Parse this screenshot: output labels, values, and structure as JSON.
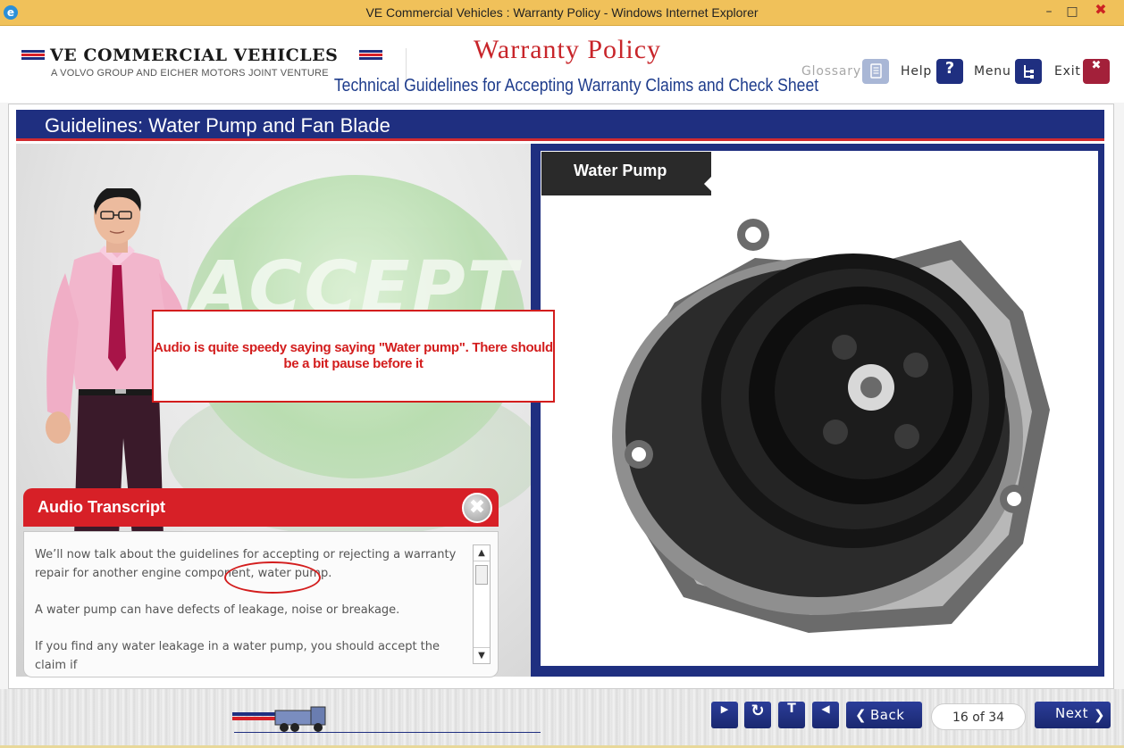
{
  "window": {
    "title": "VE Commercial Vehicles : Warranty Policy - Windows Internet Explorer",
    "app_icon": "internet-explorer-icon",
    "controls": {
      "minimize": "–",
      "maximize": "□",
      "close": "✖"
    }
  },
  "header": {
    "logo_name": "VE COMMERCIAL VEHICLES",
    "logo_tagline": "A VOLVO GROUP AND EICHER MOTORS JOINT VENTURE",
    "course_title": "Warranty Policy",
    "course_subtitle": "Technical Guidelines for Accepting Warranty Claims and Check Sheet",
    "buttons": [
      {
        "label": "Glossary",
        "icon": "glossary-icon",
        "disabled": true
      },
      {
        "label": "Help",
        "icon": "help-icon",
        "glyph": "?"
      },
      {
        "label": "Menu",
        "icon": "menu-icon"
      },
      {
        "label": "Exit",
        "icon": "exit-icon",
        "glyph": "✖"
      }
    ]
  },
  "slide": {
    "title": "Guidelines: Water Pump and Fan Blade",
    "background_word": "ACCEPT",
    "image_label": "Water Pump"
  },
  "annotation": {
    "text": "Audio is quite speedy saying saying \"Water pump\". There should be a bit pause before it",
    "color": "#d31d1d"
  },
  "transcript": {
    "title": "Audio Transcript",
    "close_glyph": "✖",
    "paragraphs": [
      "We’ll now talk about the guidelines for accepting or rejecting a warranty repair for another engine component, water pump.",
      "A water pump can have defects of leakage, noise or breakage.",
      "If you find any water leakage in a water pump, you should accept the claim if"
    ],
    "scroll_up": "▲",
    "scroll_down": "▼"
  },
  "footer": {
    "controls": [
      {
        "name": "play-icon",
        "glyph": "▶"
      },
      {
        "name": "replay-icon",
        "glyph": "↻"
      },
      {
        "name": "transcript-toggle-icon",
        "glyph": "T"
      },
      {
        "name": "audio-icon",
        "glyph": "◀"
      }
    ],
    "back_label": "Back",
    "back_arrow": "❮",
    "next_label": "Next",
    "next_arrow": "❯",
    "page_indicator": "16 of 34"
  },
  "colors": {
    "brand_blue": "#1f2f80",
    "brand_red": "#d72027",
    "title_bar": "#f0c15a"
  }
}
